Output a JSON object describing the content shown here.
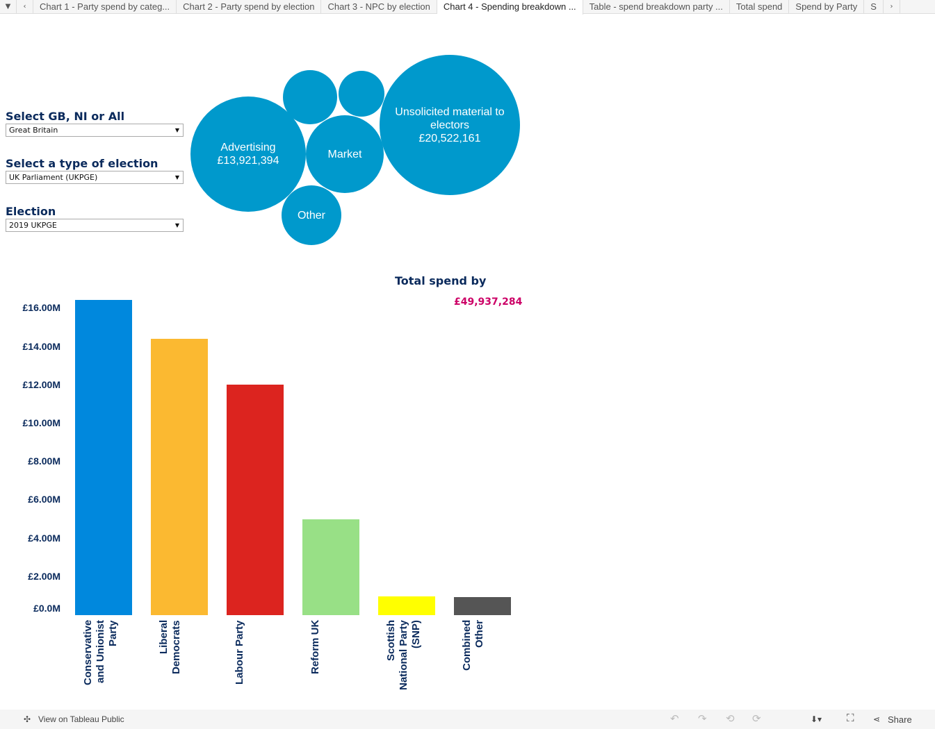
{
  "tabs": [
    "Chart 1 - Party spend by categ...",
    "Chart 2 - Party spend by election",
    "Chart 3 - NPC by election",
    "Chart 4 - Spending breakdown ...",
    "Table - spend breakdown party ...",
    "Total spend",
    "Spend by Party",
    "S"
  ],
  "active_tab": 3,
  "filters": [
    {
      "label": "Select GB, NI or All",
      "value": "Great Britain"
    },
    {
      "label": "Select a type of election",
      "value": "UK Parliament (UKPGE)"
    },
    {
      "label": "Election",
      "value": "2019 UKPGE"
    }
  ],
  "bubbles": [
    {
      "label": "Advertising",
      "value": "£13,921,394"
    },
    {
      "label": "Market",
      "value": ""
    },
    {
      "label": "Unsolicited material to electors",
      "value": "£20,522,161"
    },
    {
      "label": "Other",
      "value": ""
    }
  ],
  "bubble_color": "#0099cc",
  "chart_data": {
    "type": "bar",
    "title": "Total spend by",
    "total": "£49,937,284",
    "categories": [
      "Conservative and Unionist Party",
      "Liberal Democrats",
      "Labour Party",
      "Reform UK",
      "Scottish National Party (SNP)",
      "Combined Other"
    ],
    "values": [
      16.45,
      14.42,
      12.03,
      5.0,
      0.98,
      0.94
    ],
    "unit": "£M",
    "colors": [
      "#0088dd",
      "#fbb931",
      "#dc241f",
      "#98e086",
      "#ffff00",
      "#555555"
    ],
    "yticks": [
      "£0.0M",
      "£2.00M",
      "£4.00M",
      "£6.00M",
      "£8.00M",
      "£10.00M",
      "£12.00M",
      "£14.00M",
      "£16.00M"
    ],
    "ylim": [
      0,
      16.5
    ]
  },
  "footer": {
    "view": "View on Tableau Public",
    "share": "Share"
  }
}
